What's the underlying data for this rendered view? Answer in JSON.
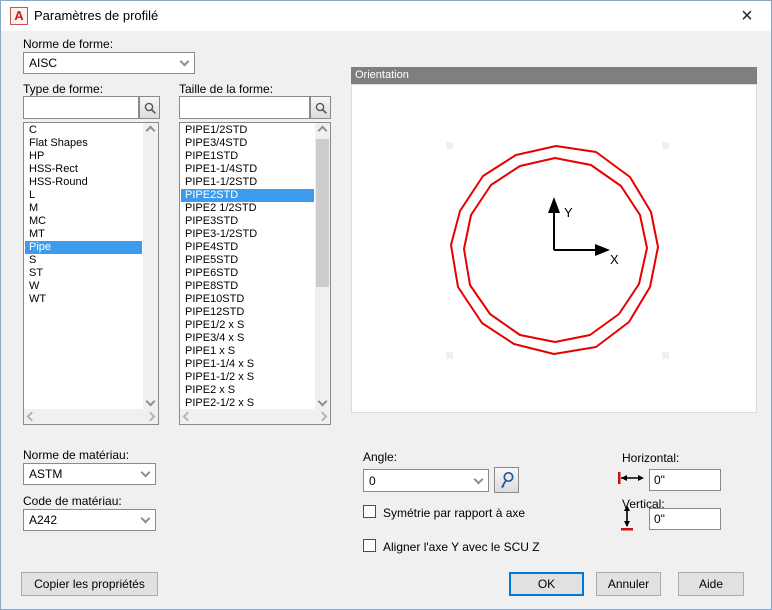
{
  "window": {
    "title": "Paramètres de profilé",
    "app_icon": "A",
    "close_icon": "×"
  },
  "shape_standard": {
    "label": "Norme de forme:",
    "value": "AISC"
  },
  "shape_type": {
    "label": "Type de forme:",
    "filter_value": "",
    "selected": "Pipe",
    "items": [
      "C",
      "Flat Shapes",
      "HP",
      "HSS-Rect",
      "HSS-Round",
      "L",
      "M",
      "MC",
      "MT",
      "Pipe",
      "S",
      "ST",
      "W",
      "WT"
    ]
  },
  "shape_size": {
    "label": "Taille de la forme:",
    "filter_value": "",
    "selected": "PIPE2STD",
    "items": [
      "PIPE1/2STD",
      "PIPE3/4STD",
      "PIPE1STD",
      "PIPE1-1/4STD",
      "PIPE1-1/2STD",
      "PIPE2STD",
      "PIPE2 1/2STD",
      "PIPE3STD",
      "PIPE3-1/2STD",
      "PIPE4STD",
      "PIPE5STD",
      "PIPE6STD",
      "PIPE8STD",
      "PIPE10STD",
      "PIPE12STD",
      "PIPE1/2 x S",
      "PIPE3/4 x S",
      "PIPE1 x S",
      "PIPE1-1/4 x S",
      "PIPE1-1/2 x S",
      "PIPE2 x S",
      "PIPE2-1/2 x S"
    ]
  },
  "orientation": {
    "header": "Orientation",
    "axis_x": "X",
    "axis_y": "Y"
  },
  "material_standard": {
    "label": "Norme de matériau:",
    "value": "ASTM"
  },
  "material_code": {
    "label": "Code de matériau:",
    "value": "A242"
  },
  "angle": {
    "label": "Angle:",
    "value": "0"
  },
  "options": {
    "mirror_label": "Symétrie par rapport à axe",
    "mirror_checked": false,
    "align_label": "Aligner l'axe Y avec le SCU Z",
    "align_checked": false
  },
  "offsets": {
    "horizontal_label": "Horizontal:",
    "horizontal_value": "0\"",
    "vertical_label": "Vertical:",
    "vertical_value": "0\""
  },
  "buttons": {
    "copy_properties": "Copier les propriétés",
    "ok": "OK",
    "cancel": "Annuler",
    "help": "Aide"
  },
  "colors": {
    "selection_blue": "#3d9bee",
    "shape_red": "#e60000",
    "orientation_header_gray": "#7f7f7f",
    "default_button_blue": "#0078d7",
    "dialog_border_blue": "#8aa8c6"
  }
}
